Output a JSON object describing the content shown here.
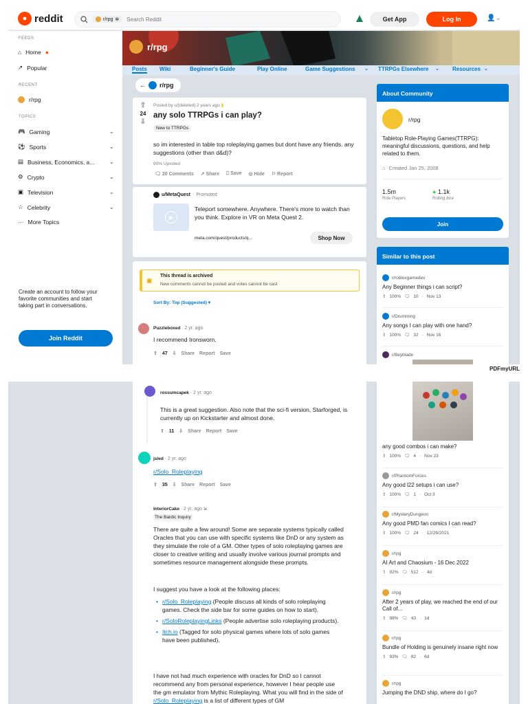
{
  "header": {
    "logo_text": "reddit",
    "search_chip": "r/rpg",
    "search_placeholder": "Search Reddit",
    "get_app": "Get App",
    "login": "Log In"
  },
  "sidebar": {
    "feeds_label": "FEEDS",
    "home": "Home",
    "popular": "Popular",
    "recent_label": "RECENT",
    "recent_item": "r/rpg",
    "topics_label": "TOPICS",
    "topics": [
      "Gaming",
      "Sports",
      "Business, Economics, a...",
      "Crypto",
      "Television",
      "Celebrity",
      "More Topics"
    ],
    "cta_text": "Create an account to follow your favorite communities and start taking part in conversations.",
    "join_button": "Join Reddit"
  },
  "subreddit": {
    "name": "r/rpg",
    "tabs": [
      "Posts",
      "Wiki",
      "Beginner's Guide",
      "Play Online",
      "Game Suggestions",
      "TTRPGs Elsewhere",
      "Resources"
    ]
  },
  "post": {
    "back_label": "r/rpg",
    "meta": "Posted by u/[deleted] 2 years ago",
    "votes": "24",
    "title": "any solo TTRPGs i can play?",
    "flair": "New to TTRPGs",
    "body": "so im interested in table top roleplaying games but dont have any friends. any suggestions (other than d&d)?",
    "upvoted": "90% Upvoted",
    "comments": "20 Comments",
    "share": "Share",
    "save": "Save",
    "hide": "Hide",
    "report": "Report"
  },
  "promo": {
    "author": "u/MetaQuest",
    "promoted": "Promoted",
    "text": "Teleport somewhere. Anywhere. There's more to watch than you think. Explore in VR on Meta Quest 2.",
    "url": "meta.com/quest/products/q...",
    "cta": "Shop Now"
  },
  "archived": {
    "title": "This thread is archived",
    "subtitle": "New comments cannot be posted and votes cannot be cast"
  },
  "sort_label": "Sort By: Top (Suggested)",
  "comments": [
    {
      "user": "Puzzleboxed",
      "time": "2 yr. ago",
      "text": "I recommend Ironsworn.",
      "votes": "47"
    },
    {
      "user": "rossumcapek",
      "time": "2 yr. ago",
      "text": "This is a great suggestion. Also note that the sci-fi version, Starforged, is currently up on Kickstarter and almost done.",
      "votes": "11"
    },
    {
      "user": "jsled",
      "time": "2 yr. ago",
      "text": "r/Solo_Roleplaying",
      "votes": "35"
    },
    {
      "user": "InteriorCake",
      "time": "2 yr. ago",
      "flair": "The Bardic Inquiry",
      "p1": "There are quite a few around! Some are separate systems typically called Oracles that you can use with specific systems like DnD or any system as they simulate the role of a GM. Other types of solo roleplaying games are closer to creative writing and usually involve various journal prompts and sometimes resource management alongside these prompts.",
      "p2": "I suggest you have a look at the following places:",
      "li1_link": "r/Solo_Roleplaying",
      "li1_text": " (People discuss all kinds of solo roleplaying games. Check the side bar for some guides on how to start).",
      "li2_link": "r/SoloRoleplayingLinks",
      "li2_text": " (People advertise solo roleplaying products).",
      "li3_link": "Itch.io",
      "li3_text": " (Tagged for solo physical games where lots of solo games have been published).",
      "p3a": "I have not had much experience with oracles for DnD so I cannot recommend any from personal experience, however I hear people use the gm emulator from Mythic Roleplaying. What you will find in the side of ",
      "p3_link": "r/Solo_Roleplaying",
      "p3b": " is a list of different types of GM"
    }
  ],
  "actions": {
    "share": "Share",
    "report": "Report",
    "save": "Save"
  },
  "about": {
    "heading": "About Community",
    "name": "r/rpg",
    "description": "Tabletop Role-Playing Games(TTRPG): meaningful discussions, questions, and help related to them.",
    "created": "Created Jan 25, 2008",
    "members": "1.5m",
    "members_label": "Role Players",
    "online": "1.1k",
    "online_label": "Rolling dice",
    "join": "Join"
  },
  "similar": {
    "heading": "Similar to this post",
    "items": [
      {
        "sub": "r/robloxgamedev",
        "title": "Any Beginner things i can script?",
        "pct": "100%",
        "comments": "10",
        "date": "Nov 13"
      },
      {
        "sub": "r/Drumming",
        "title": "Any songs I can play with one hand?",
        "pct": "100%",
        "comments": "32",
        "date": "Nov 16"
      },
      {
        "sub": "r/Beyblade",
        "title": "any good combos i can make?",
        "pct": "100%",
        "comments": "4",
        "date": "Nov 23"
      },
      {
        "sub": "r/PhantomForces",
        "title": "Any good l22 setups i can use?",
        "pct": "100%",
        "comments": "1",
        "date": "Oct 3"
      },
      {
        "sub": "r/MysteryDungeon",
        "title": "Any good PMD fan comics I can read?",
        "pct": "100%",
        "comments": "24",
        "date": "12/26/2021"
      },
      {
        "sub": "r/rpg",
        "title": "AI Art and Chaosium - 16 Dec 2022",
        "pct": "92%",
        "comments": "512",
        "date": "4d"
      },
      {
        "sub": "r/rpg",
        "title": "After 2 years of play, we reached the end of our Call of...",
        "pct": "98%",
        "comments": "43",
        "date": "1d"
      },
      {
        "sub": "r/rpg",
        "title": "Bundle of Holding is genuinely insane right now",
        "pct": "93%",
        "comments": "82",
        "date": "6d"
      },
      {
        "sub": "r/rpg",
        "title": "Jumping the DND ship, where do I go?",
        "pct": "",
        "comments": "",
        "date": ""
      }
    ]
  },
  "watermark": "PDFmyURL",
  "colors": {
    "brand": "#ff4500",
    "accent": "#0079d3",
    "bg": "#dae0e6"
  }
}
